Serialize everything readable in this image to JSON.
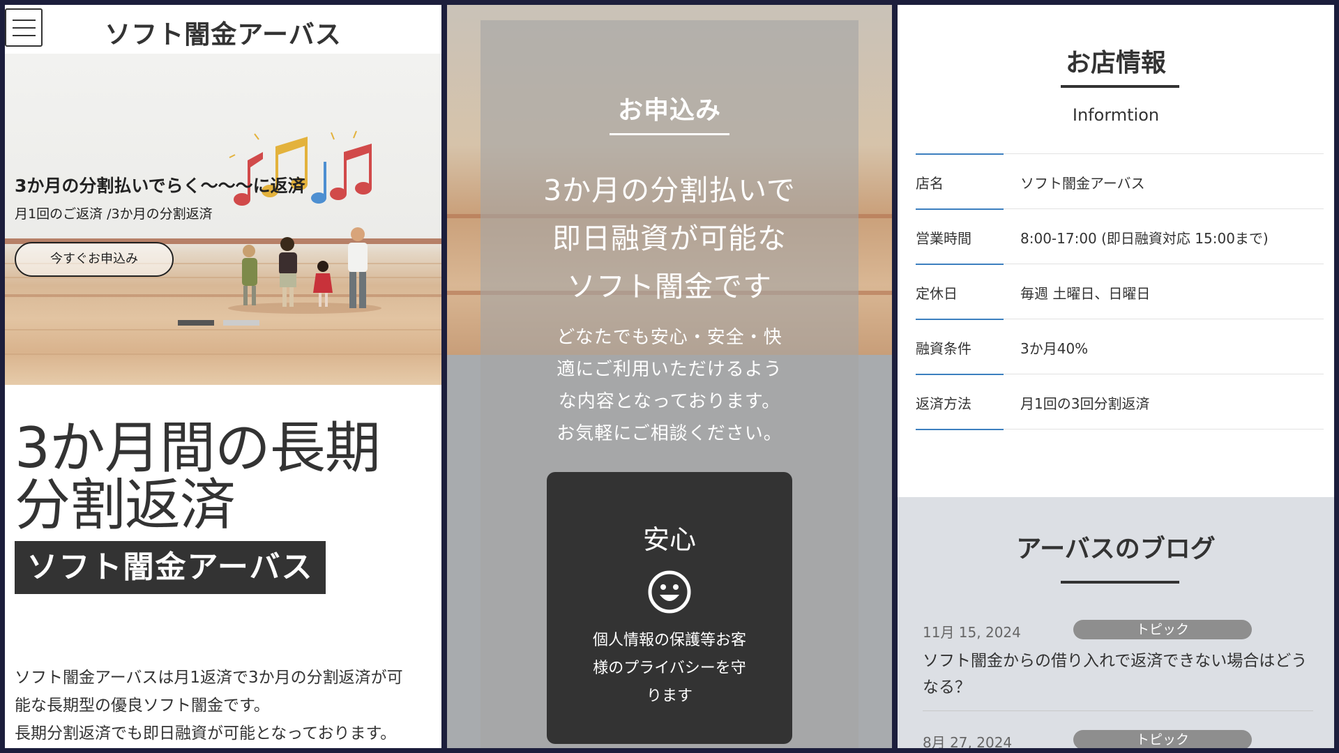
{
  "site": {
    "name": "ソフト闇金アーバス",
    "hero": {
      "title": "3か月の分割払いでらく〜〜〜に返済",
      "subtitle": "月1回のご返済 /3か月の分割返済",
      "cta_label": "今すぐお申込み",
      "slide_count": 2,
      "active_slide": 1
    },
    "headline": [
      "3か月間の長期",
      "分割返済"
    ],
    "brand_box": "ソフト闇金アーバス",
    "intro": [
      "ソフト闇金アーバスは月1返済で3か月の分割返済が可",
      "能な長期型の優良ソフト闇金です。",
      "長期分割返済でも即日融資が可能となっております。"
    ]
  },
  "apply": {
    "title": "お申込み",
    "lead": [
      "3か月の分割払いで",
      "即日融資が可能な",
      "ソフト闇金です"
    ],
    "body": [
      "どなたでも安心・安全・快",
      "適にご利用いただけるよう",
      "な内容となっております。",
      "お気軽にご相談ください。"
    ],
    "feature": {
      "title": "安心",
      "icon": "smiley-icon",
      "text": [
        "個人情報の保護等お客",
        "様のプライバシーを守",
        "ります"
      ]
    }
  },
  "shop_info": {
    "title": "お店情報",
    "subtitle": "Informtion",
    "rows": [
      {
        "key": "店名",
        "value": "ソフト闇金アーバス"
      },
      {
        "key": "営業時間",
        "value": "8:00-17:00 (即日融資対応 15:00まで)"
      },
      {
        "key": "定休日",
        "value": "毎週 土曜日、日曜日"
      },
      {
        "key": "融資条件",
        "value": "3か月40%"
      },
      {
        "key": "返済方法",
        "value": "月1回の3回分割返済"
      }
    ]
  },
  "blog": {
    "title": "アーバスのブログ",
    "posts": [
      {
        "date": "11月 15, 2024",
        "category": "トピック",
        "title": "ソフト闇金からの借り入れで返済できない場合はどうなる？"
      },
      {
        "date": "8月 27, 2024",
        "category": "トピック",
        "title": ""
      }
    ]
  },
  "colors": {
    "dark": "#333333",
    "accent_line": "#3c7fbf",
    "frame_bg": "#1c1e3c",
    "blog_bg": "#dcdfe4",
    "category_pill": "#8e8e8e"
  }
}
